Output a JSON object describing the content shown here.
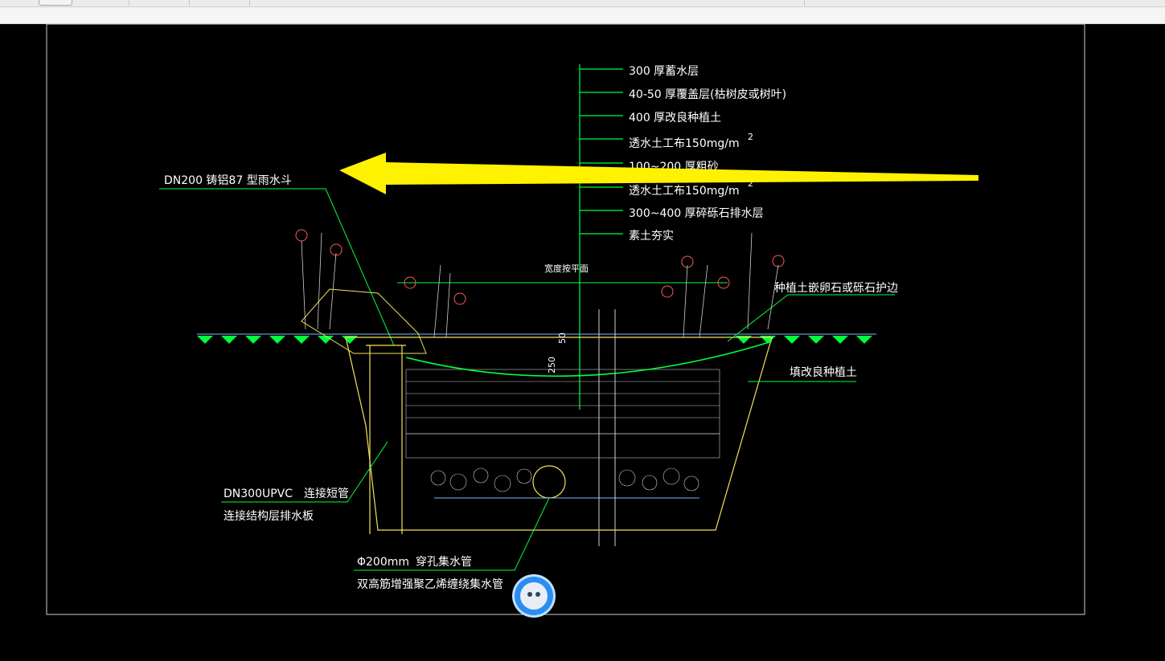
{
  "toolbar": {
    "buttons": 6
  },
  "drawing": {
    "layers_callouts": [
      "300  厚蓄水层",
      "40-50   厚覆盖层(枯树皮或树叶)",
      "400  厚改良种植土",
      "透水土工布150mg/m",
      "100~200     厚粗砂",
      "透水土工布150mg/m",
      "300~400    厚碎砾石排水层",
      "素土夯实"
    ],
    "superscript": "2",
    "left_labels": {
      "rain_hopper": "DN200   铸铝87 型雨水斗",
      "pipe": "DN300UPVC",
      "pipe_connect": "连接短管",
      "drain_board": "连接结构层排水板"
    },
    "bottom_labels": {
      "collector_size": "Φ200mm",
      "collector_name": "穿孔集水管",
      "collector_desc": "双高筋增强聚乙烯缠绕集水管"
    },
    "right_labels": {
      "edge": "种植土嵌卵石或砾石护边",
      "fill": "填改良种植土"
    },
    "center_label": "宽度按平面",
    "dim_50": "50",
    "dim_250": "250"
  },
  "colors": {
    "background": "#000000",
    "annotation_arrow": "#fff200",
    "leader_green": "#00ff3c",
    "soil_yellow": "#f5e25a"
  },
  "assistant": {
    "icon": "assistant-bot-icon"
  }
}
